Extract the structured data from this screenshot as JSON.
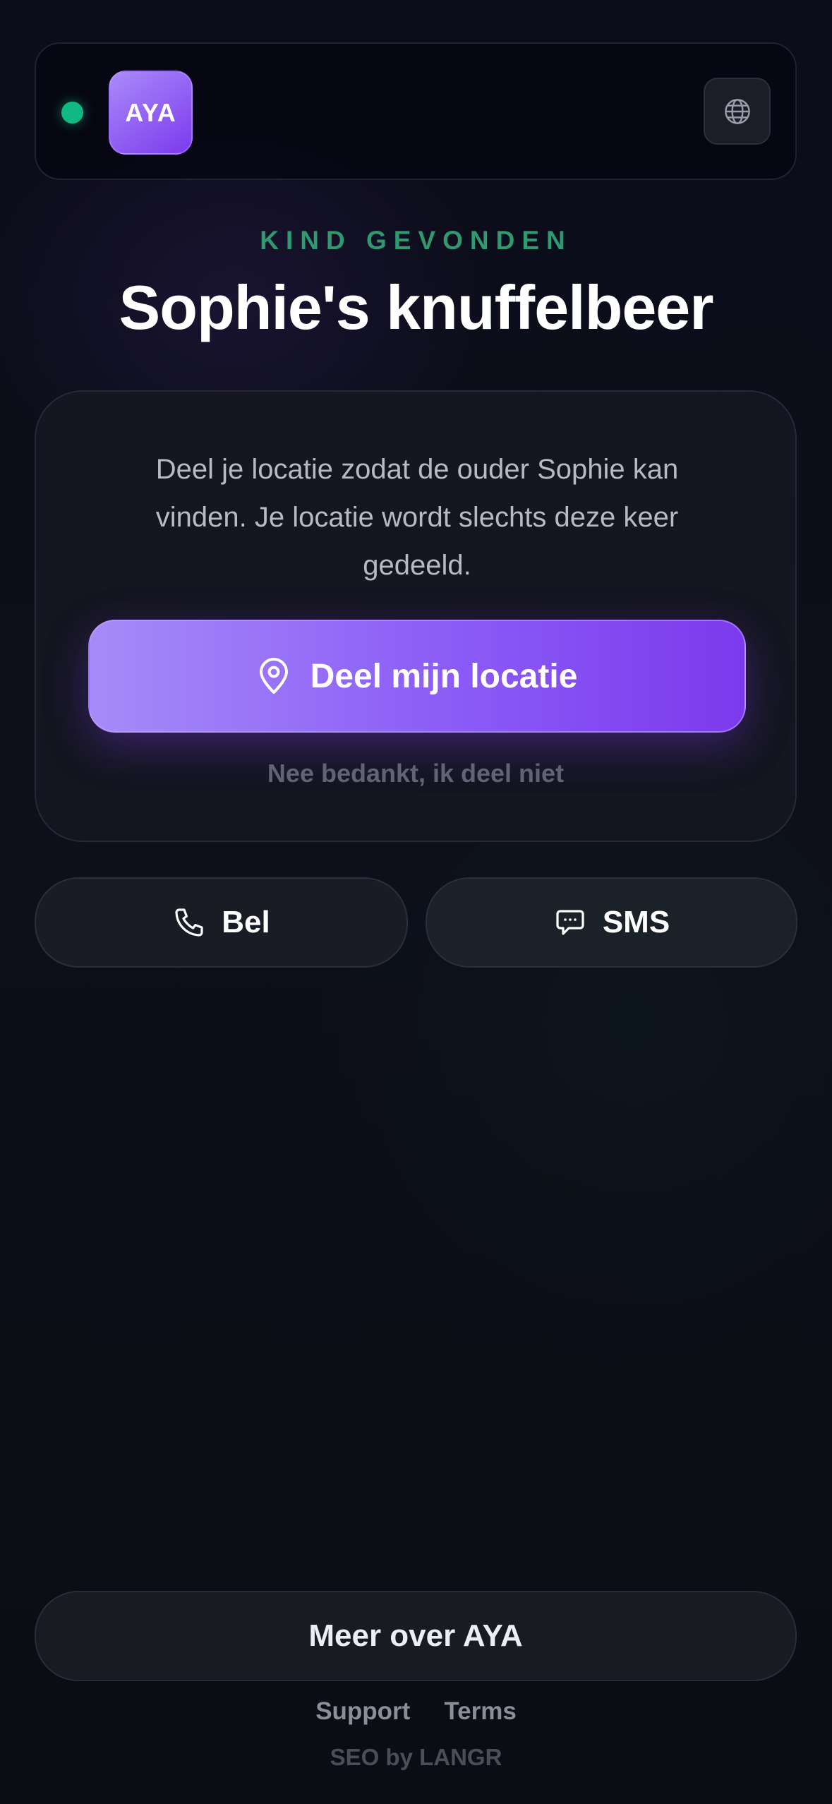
{
  "header": {
    "status": "online",
    "logo_text": "AYA",
    "language_icon": "globe-icon"
  },
  "hero": {
    "eyebrow": "KIND GEVONDEN",
    "title": "Sophie's knuffelbeer"
  },
  "card": {
    "description": "Deel je locatie zodat de ouder Sophie kan vinden. Je locatie wordt slechts deze keer gedeeld.",
    "share_button": {
      "icon": "location-pin-icon",
      "label": "Deel mijn locatie"
    },
    "decline_link": "Nee bedankt, ik deel niet"
  },
  "contact": {
    "call": {
      "icon": "phone-icon",
      "label": "Bel"
    },
    "sms": {
      "icon": "chat-bubble-icon",
      "label": "SMS"
    }
  },
  "footer": {
    "more_button": "Meer over AYA",
    "links": [
      "Support",
      "Terms"
    ],
    "credit": "SEO by LANGR"
  },
  "colors": {
    "accent_purple": "#7c3aed",
    "accent_purple_light": "#a68bf8",
    "status_green": "#10b981",
    "eyebrow_green": "#2f9a70",
    "background": "#0c0c1a"
  }
}
